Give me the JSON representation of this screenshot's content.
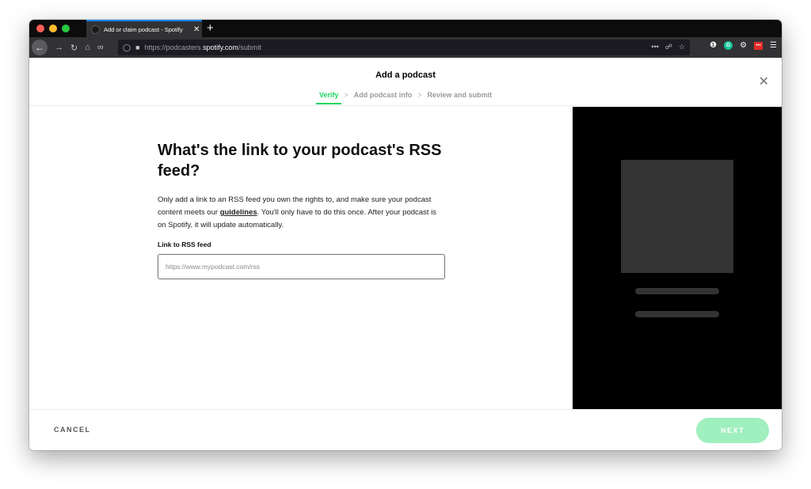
{
  "browser": {
    "tab_title": "Add or claim podcast - Spotify",
    "tab_close": "✕",
    "new_tab": "+",
    "url_prefix": "https://podcasters.",
    "url_domain": "spotify.com",
    "url_path": "/submit",
    "url_more": "•••"
  },
  "header": {
    "title": "Add a podcast",
    "steps": [
      "Verify",
      "Add podcast info",
      "Review and submit"
    ],
    "separator": ">",
    "close": "✕"
  },
  "main": {
    "heading": "What's the link to your podcast's RSS feed?",
    "desc_part1": "Only add a link to an RSS feed you own the rights to, and make sure your podcast content meets our ",
    "desc_link": "guidelines",
    "desc_part2": ". You'll only have to do this once. After your podcast is on Spotify, it will update automatically.",
    "field_label": "Link to RSS feed",
    "field_placeholder": "https://www.mypodcast.com/rss",
    "field_value": ""
  },
  "footer": {
    "cancel_label": "CANCEL",
    "next_label": "NEXT"
  },
  "colors": {
    "accent": "#1ed760",
    "next_disabled": "#a0efbe",
    "preview_bg": "#000000"
  }
}
